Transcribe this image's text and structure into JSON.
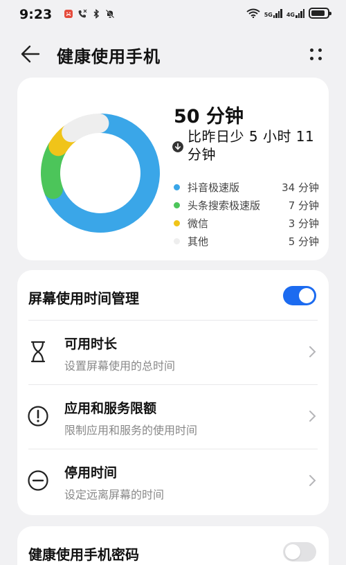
{
  "status_bar": {
    "time": "9:23",
    "icons_left": [
      "app-notification-icon",
      "missed-call-icon",
      "bluetooth-icon",
      "mute-icon"
    ],
    "sim1_label": "5G",
    "sim2_label": "4G",
    "battery_percent": 85
  },
  "header": {
    "title": "健康使用手机",
    "back_icon": "arrow-left-icon",
    "more_icon": "more-dots-icon"
  },
  "usage": {
    "total": "50 分钟",
    "compare": "比昨日少 5 小时 11 分钟",
    "compare_icon": "arrow-down-circle-icon",
    "apps": [
      {
        "name": "抖音极速版",
        "time": "34 分钟",
        "minutes": 34,
        "color": "#3aa6e8"
      },
      {
        "name": "头条搜索极速版",
        "time": "7 分钟",
        "minutes": 7,
        "color": "#4cc55a"
      },
      {
        "name": "微信",
        "time": "3 分钟",
        "minutes": 3,
        "color": "#f0c419"
      },
      {
        "name": "其他",
        "time": "5 分钟",
        "minutes": 5,
        "color": "#eeeeee"
      }
    ]
  },
  "management": {
    "title": "屏幕使用时间管理",
    "toggle_on": true,
    "accent_color": "#1c6bf0",
    "items": [
      {
        "title": "可用时长",
        "subtitle": "设置屏幕使用的总时间",
        "icon": "hourglass-icon"
      },
      {
        "title": "应用和服务限额",
        "subtitle": "限制应用和服务的使用时间",
        "icon": "exclamation-circle-icon"
      },
      {
        "title": "停用时间",
        "subtitle": "设定远离屏幕的时间",
        "icon": "minus-circle-icon"
      }
    ]
  },
  "password": {
    "title": "健康使用手机密码",
    "toggle_on": false
  }
}
